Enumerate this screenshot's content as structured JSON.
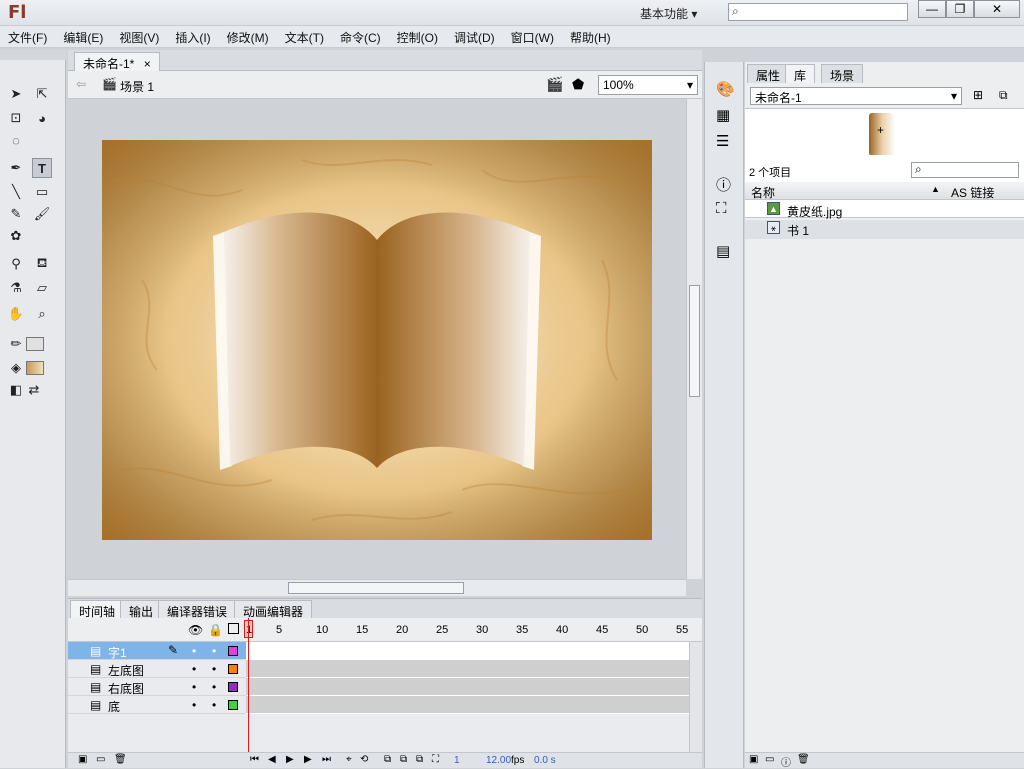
{
  "app": {
    "logo": "Fl",
    "workspace": "基本功能",
    "search_placeholder": ""
  },
  "window_buttons": {
    "minimize": "—",
    "restore": "❐",
    "close": "✕"
  },
  "menu": [
    "文件(F)",
    "编辑(E)",
    "视图(V)",
    "插入(I)",
    "修改(M)",
    "文本(T)",
    "命令(C)",
    "控制(O)",
    "调试(D)",
    "窗口(W)",
    "帮助(H)"
  ],
  "document": {
    "tab_label": "未命名-1*",
    "tab_close": "×",
    "scene": "场景 1",
    "zoom": "100%"
  },
  "timeline": {
    "tabs": [
      "时间轴",
      "输出",
      "编译器错误",
      "动画编辑器"
    ],
    "frame_numbers": [
      "1",
      "5",
      "10",
      "15",
      "20",
      "25",
      "30",
      "35",
      "40",
      "45",
      "50",
      "55"
    ],
    "layers": [
      {
        "name": "字1",
        "color": "#e040e0",
        "selected": true
      },
      {
        "name": "左底图",
        "color": "#ff7f00",
        "selected": false
      },
      {
        "name": "右底图",
        "color": "#9030c0",
        "selected": false
      },
      {
        "name": "底",
        "color": "#40d040",
        "selected": false
      }
    ],
    "footer": {
      "current_frame": "1",
      "fps": "12.00",
      "fps_unit": "fps",
      "time": "0.0 s"
    }
  },
  "library": {
    "tabs": [
      "属性",
      "库",
      "场景"
    ],
    "document": "未命名-1",
    "item_count": "2 个项目",
    "columns": {
      "name": "名称",
      "linkage": "AS 链接"
    },
    "items": [
      {
        "name": "黄皮纸.jpg",
        "type": "bitmap"
      },
      {
        "name": "书 1",
        "type": "graphic"
      }
    ]
  },
  "colors": {
    "accent": "#7fb4e9",
    "playhead": "#d02020"
  }
}
